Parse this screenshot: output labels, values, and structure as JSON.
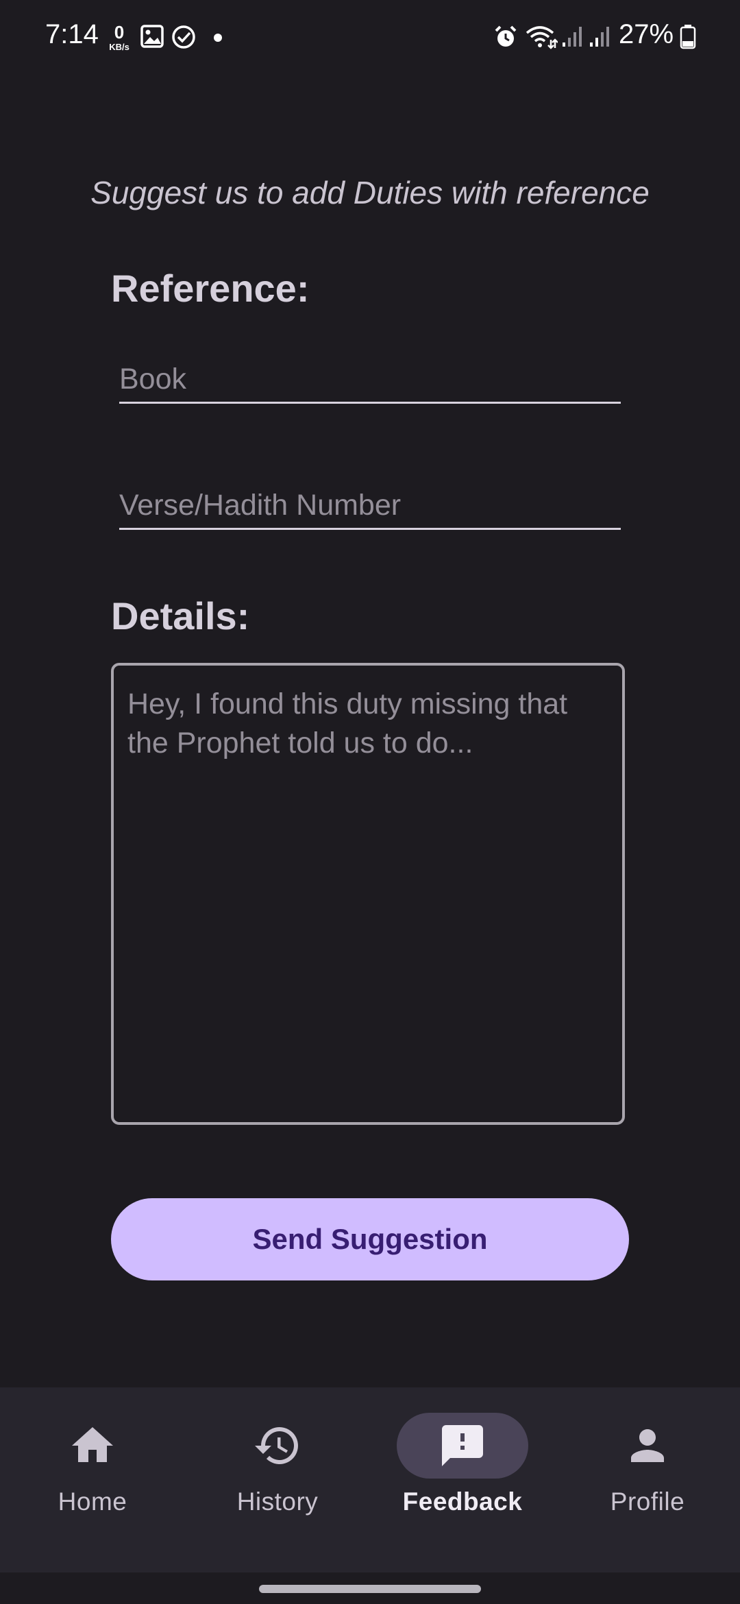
{
  "status_bar": {
    "time": "7:14",
    "net_speed_value": "0",
    "net_speed_unit": "KB/s",
    "battery": "27%"
  },
  "form": {
    "intro": "Suggest us to add Duties with reference",
    "reference_title": "Reference:",
    "book_placeholder": "Book",
    "verse_placeholder": "Verse/Hadith Number",
    "details_title": "Details:",
    "details_placeholder": "Hey, I found this duty missing that the Prophet told us to do...",
    "send_label": "Send Suggestion"
  },
  "nav": {
    "items": [
      {
        "label": "Home",
        "icon": "home-icon"
      },
      {
        "label": "History",
        "icon": "history-icon"
      },
      {
        "label": "Feedback",
        "icon": "feedback-icon",
        "active": true
      },
      {
        "label": "Profile",
        "icon": "profile-icon"
      }
    ]
  },
  "colors": {
    "background": "#1d1b20",
    "primary_button": "#d0bcff",
    "primary_button_text": "#381e72",
    "nav_background": "#27252d",
    "active_indicator": "#4a4458"
  }
}
